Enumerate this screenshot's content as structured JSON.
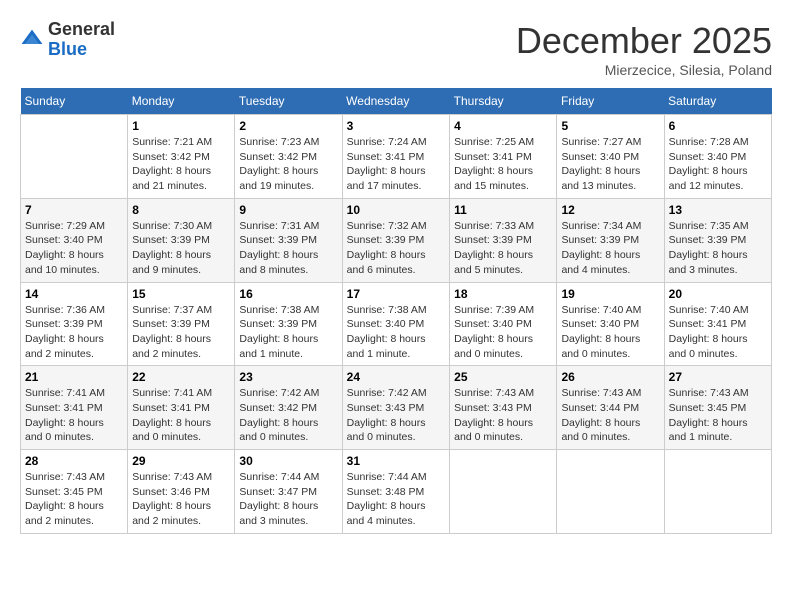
{
  "logo": {
    "general": "General",
    "blue": "Blue"
  },
  "title": {
    "month": "December 2025",
    "location": "Mierzecice, Silesia, Poland"
  },
  "days_of_week": [
    "Sunday",
    "Monday",
    "Tuesday",
    "Wednesday",
    "Thursday",
    "Friday",
    "Saturday"
  ],
  "weeks": [
    [
      {
        "day": "",
        "info": ""
      },
      {
        "day": "1",
        "info": "Sunrise: 7:21 AM\nSunset: 3:42 PM\nDaylight: 8 hours\nand 21 minutes."
      },
      {
        "day": "2",
        "info": "Sunrise: 7:23 AM\nSunset: 3:42 PM\nDaylight: 8 hours\nand 19 minutes."
      },
      {
        "day": "3",
        "info": "Sunrise: 7:24 AM\nSunset: 3:41 PM\nDaylight: 8 hours\nand 17 minutes."
      },
      {
        "day": "4",
        "info": "Sunrise: 7:25 AM\nSunset: 3:41 PM\nDaylight: 8 hours\nand 15 minutes."
      },
      {
        "day": "5",
        "info": "Sunrise: 7:27 AM\nSunset: 3:40 PM\nDaylight: 8 hours\nand 13 minutes."
      },
      {
        "day": "6",
        "info": "Sunrise: 7:28 AM\nSunset: 3:40 PM\nDaylight: 8 hours\nand 12 minutes."
      }
    ],
    [
      {
        "day": "7",
        "info": "Sunrise: 7:29 AM\nSunset: 3:40 PM\nDaylight: 8 hours\nand 10 minutes."
      },
      {
        "day": "8",
        "info": "Sunrise: 7:30 AM\nSunset: 3:39 PM\nDaylight: 8 hours\nand 9 minutes."
      },
      {
        "day": "9",
        "info": "Sunrise: 7:31 AM\nSunset: 3:39 PM\nDaylight: 8 hours\nand 8 minutes."
      },
      {
        "day": "10",
        "info": "Sunrise: 7:32 AM\nSunset: 3:39 PM\nDaylight: 8 hours\nand 6 minutes."
      },
      {
        "day": "11",
        "info": "Sunrise: 7:33 AM\nSunset: 3:39 PM\nDaylight: 8 hours\nand 5 minutes."
      },
      {
        "day": "12",
        "info": "Sunrise: 7:34 AM\nSunset: 3:39 PM\nDaylight: 8 hours\nand 4 minutes."
      },
      {
        "day": "13",
        "info": "Sunrise: 7:35 AM\nSunset: 3:39 PM\nDaylight: 8 hours\nand 3 minutes."
      }
    ],
    [
      {
        "day": "14",
        "info": "Sunrise: 7:36 AM\nSunset: 3:39 PM\nDaylight: 8 hours\nand 2 minutes."
      },
      {
        "day": "15",
        "info": "Sunrise: 7:37 AM\nSunset: 3:39 PM\nDaylight: 8 hours\nand 2 minutes."
      },
      {
        "day": "16",
        "info": "Sunrise: 7:38 AM\nSunset: 3:39 PM\nDaylight: 8 hours\nand 1 minute."
      },
      {
        "day": "17",
        "info": "Sunrise: 7:38 AM\nSunset: 3:40 PM\nDaylight: 8 hours\nand 1 minute."
      },
      {
        "day": "18",
        "info": "Sunrise: 7:39 AM\nSunset: 3:40 PM\nDaylight: 8 hours\nand 0 minutes."
      },
      {
        "day": "19",
        "info": "Sunrise: 7:40 AM\nSunset: 3:40 PM\nDaylight: 8 hours\nand 0 minutes."
      },
      {
        "day": "20",
        "info": "Sunrise: 7:40 AM\nSunset: 3:41 PM\nDaylight: 8 hours\nand 0 minutes."
      }
    ],
    [
      {
        "day": "21",
        "info": "Sunrise: 7:41 AM\nSunset: 3:41 PM\nDaylight: 8 hours\nand 0 minutes."
      },
      {
        "day": "22",
        "info": "Sunrise: 7:41 AM\nSunset: 3:41 PM\nDaylight: 8 hours\nand 0 minutes."
      },
      {
        "day": "23",
        "info": "Sunrise: 7:42 AM\nSunset: 3:42 PM\nDaylight: 8 hours\nand 0 minutes."
      },
      {
        "day": "24",
        "info": "Sunrise: 7:42 AM\nSunset: 3:43 PM\nDaylight: 8 hours\nand 0 minutes."
      },
      {
        "day": "25",
        "info": "Sunrise: 7:43 AM\nSunset: 3:43 PM\nDaylight: 8 hours\nand 0 minutes."
      },
      {
        "day": "26",
        "info": "Sunrise: 7:43 AM\nSunset: 3:44 PM\nDaylight: 8 hours\nand 0 minutes."
      },
      {
        "day": "27",
        "info": "Sunrise: 7:43 AM\nSunset: 3:45 PM\nDaylight: 8 hours\nand 1 minute."
      }
    ],
    [
      {
        "day": "28",
        "info": "Sunrise: 7:43 AM\nSunset: 3:45 PM\nDaylight: 8 hours\nand 2 minutes."
      },
      {
        "day": "29",
        "info": "Sunrise: 7:43 AM\nSunset: 3:46 PM\nDaylight: 8 hours\nand 2 minutes."
      },
      {
        "day": "30",
        "info": "Sunrise: 7:44 AM\nSunset: 3:47 PM\nDaylight: 8 hours\nand 3 minutes."
      },
      {
        "day": "31",
        "info": "Sunrise: 7:44 AM\nSunset: 3:48 PM\nDaylight: 8 hours\nand 4 minutes."
      },
      {
        "day": "",
        "info": ""
      },
      {
        "day": "",
        "info": ""
      },
      {
        "day": "",
        "info": ""
      }
    ]
  ]
}
